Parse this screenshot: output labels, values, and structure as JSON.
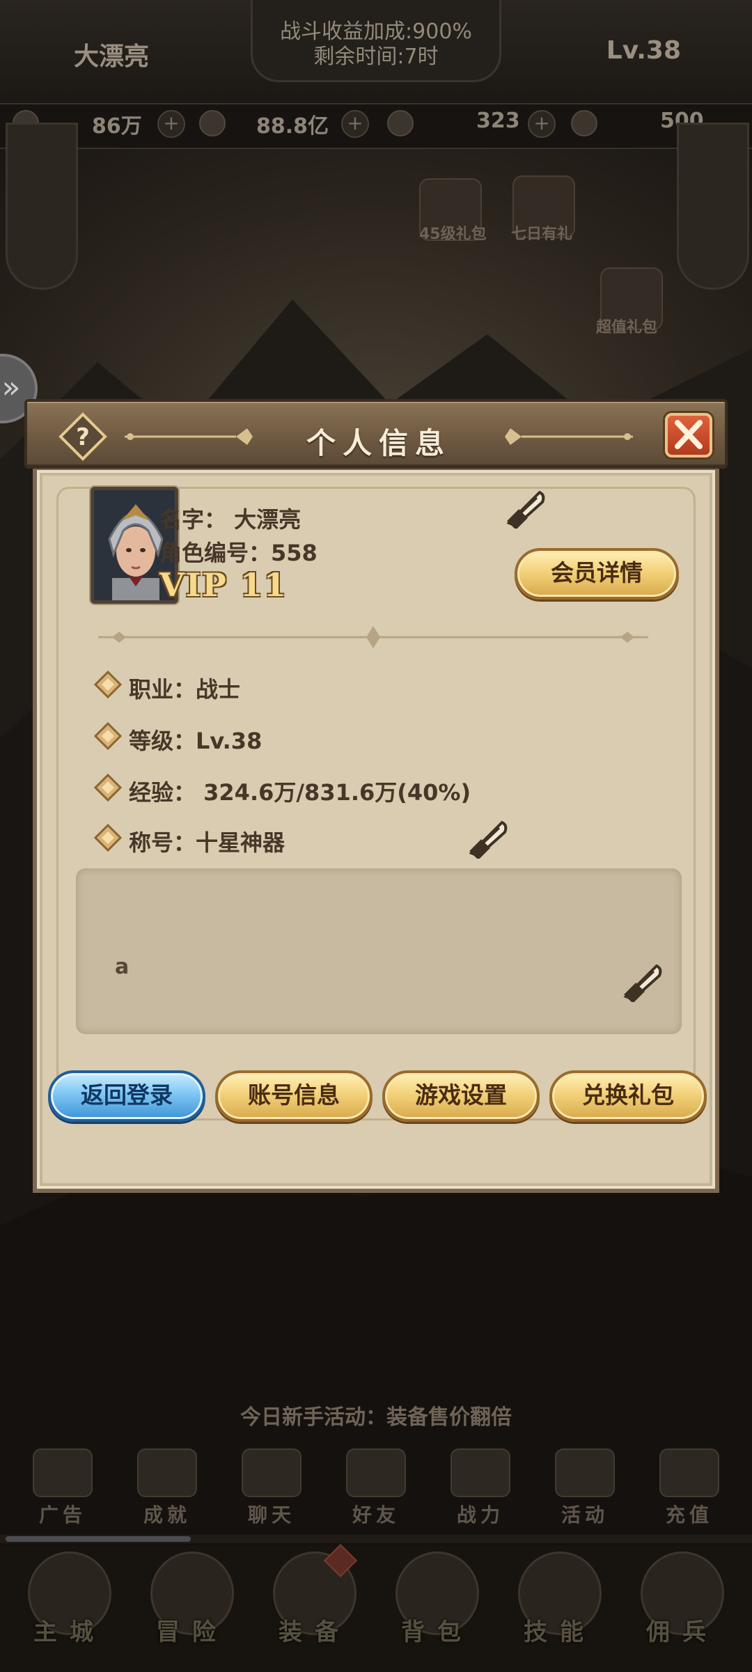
{
  "hud": {
    "player_name": "大漂亮",
    "bonus_line1": "战斗收益加成:900%",
    "bonus_line2": "剩余时间:7时",
    "level": "Lv.38",
    "resources": [
      "86万",
      "88.8亿",
      "323",
      "500"
    ],
    "top_icons": [
      "45级礼包",
      "七日有礼",
      "超值礼包"
    ],
    "activity": "今日新手活动：装备售价翻倍",
    "functions": [
      "广告",
      "成就",
      "聊天",
      "好友",
      "战力",
      "活动",
      "充值"
    ],
    "nav": [
      "主城",
      "冒险",
      "装备",
      "背包",
      "技能",
      "佣兵"
    ],
    "exp_progress_fraction": 0.25
  },
  "dialog": {
    "title": "个人信息",
    "name_line": "名字：  大漂亮",
    "id_line": "角色编号：558",
    "vip": "VIP 11",
    "vip_details_button": "会员详情",
    "stats": [
      {
        "text": "职业：战士"
      },
      {
        "text": "等级：Lv.38"
      },
      {
        "text": "经验：  324.6万/831.6万(40%)"
      },
      {
        "text": "称号：十星神器"
      }
    ],
    "signature": "a",
    "buttons": {
      "logout": "返回登录",
      "account": "账号信息",
      "settings": "游戏设置",
      "redeem": "兑换礼包"
    }
  },
  "colors": {
    "panel": "#d9ccb1",
    "header": "#6f5a42",
    "gold_button": "#f3d27a",
    "blue_button": "#7fc7f4",
    "close_button": "#c5482a"
  }
}
